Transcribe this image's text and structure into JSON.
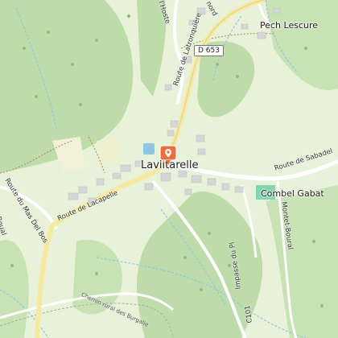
{
  "map": {
    "colors": {
      "background": "#e8f2d8",
      "forest": "#bedcaa",
      "meadow": "#f0f1d8",
      "road": "#ffffff",
      "major_road": "#f5eaa0",
      "water": "#8ec6e6",
      "building": "#d6d6d6",
      "marker": "#f26b3a"
    },
    "marker_icon": "location-pin-icon",
    "road_shield": "D 653",
    "labels": {
      "village": "Laviitarelle",
      "pech_lescure": "Pech Lescure",
      "combel_gabat": "Combel Gabat",
      "route_latronquiere": "Route de Latronquière",
      "route_sabadel": "Route de Sabadel",
      "route_lacapelle": "Route de Lacapelle",
      "route_mas_del_bos": "Route du Mas Del Bos",
      "montet_boural": "Montet-Boural",
      "impasse": "Impasse du Pl",
      "c101": "C101",
      "chemin_rural": "Chemin rural des Burgalie",
      "lhoste": "l'Hoste",
      "nord": "nord",
      "boual": "Boual"
    }
  }
}
